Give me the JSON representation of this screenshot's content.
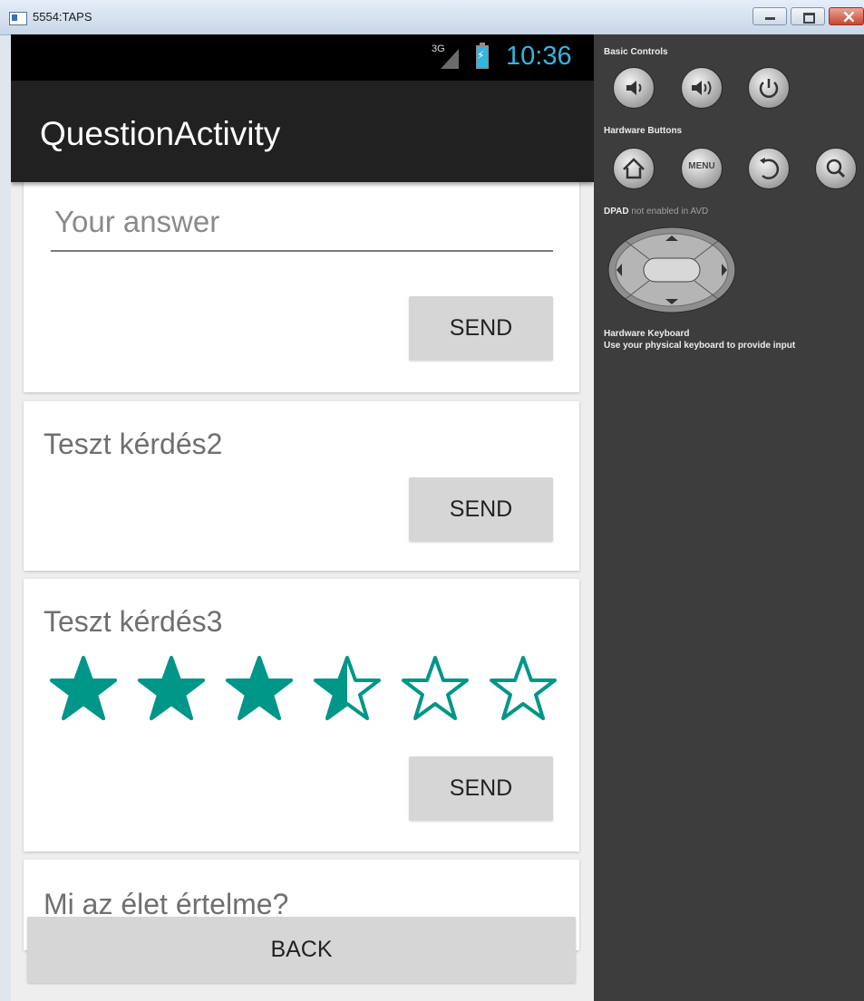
{
  "window": {
    "title": "5554:TAPS"
  },
  "statusbar": {
    "network": "3G",
    "time": "10:36"
  },
  "actionbar": {
    "title": "QuestionActivity"
  },
  "questions": [
    {
      "answer_placeholder": "Your answer",
      "send_label": "SEND"
    },
    {
      "text": "Teszt kérdés2",
      "send_label": "SEND"
    },
    {
      "text": "Teszt kérdés3",
      "rating": 3.5,
      "max_rating": 6,
      "send_label": "SEND"
    },
    {
      "text": "Mi az élet értelme?"
    }
  ],
  "back_label": "BACK",
  "panel": {
    "basic_controls_label": "Basic Controls",
    "hardware_buttons_label": "Hardware Buttons",
    "menu_label": "MENU",
    "dpad_label": "DPAD",
    "dpad_status": "not enabled in AVD",
    "keyboard_label": "Hardware Keyboard",
    "keyboard_hint": "Use your physical keyboard to provide input"
  },
  "colors": {
    "accent": "#009688",
    "clock": "#33b5e5",
    "actionbar": "#212121"
  }
}
